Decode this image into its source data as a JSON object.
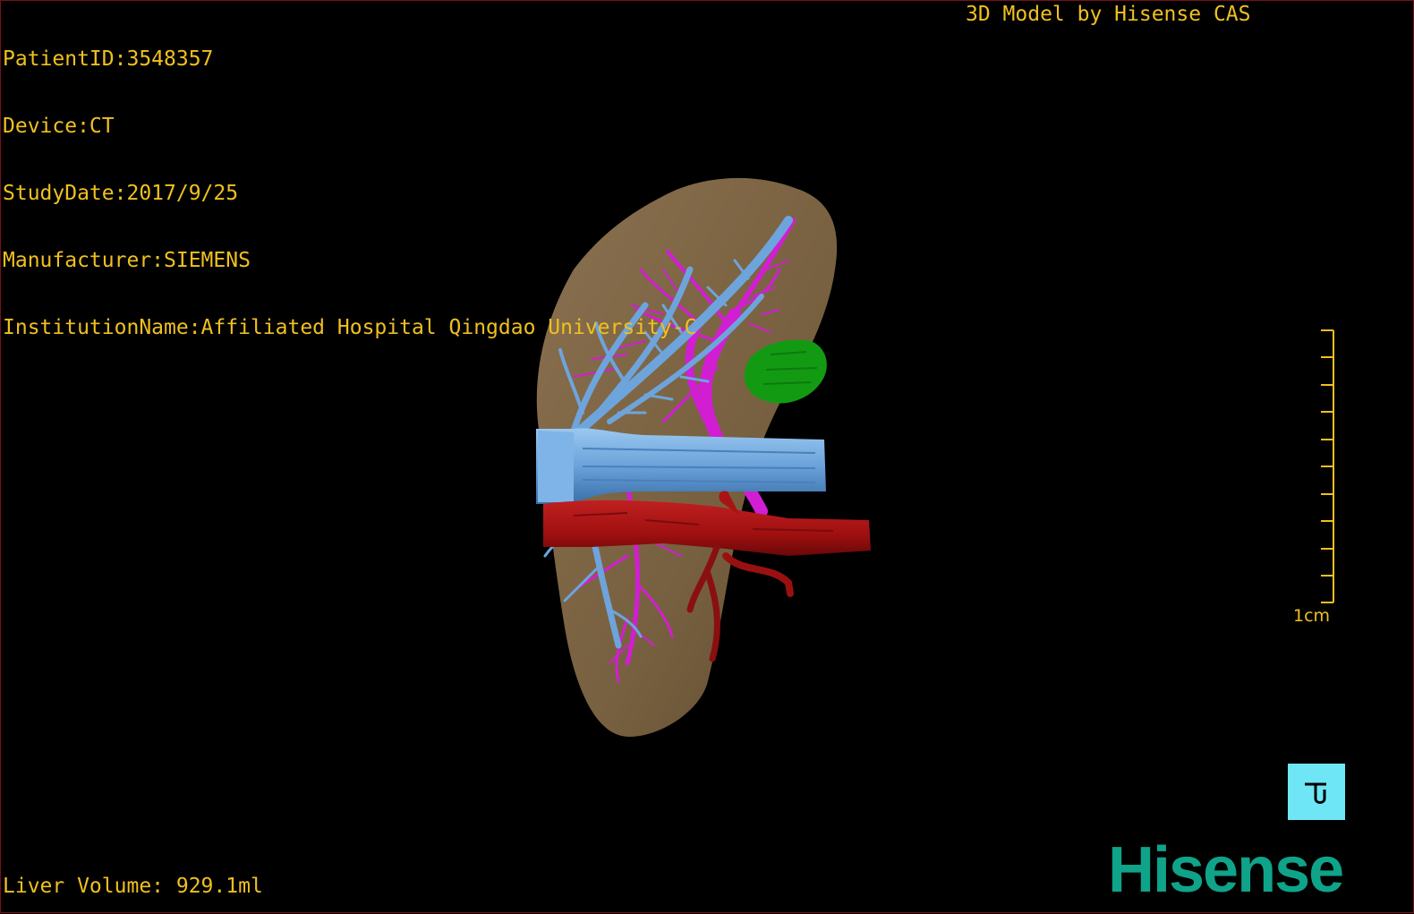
{
  "patient_info": {
    "patient_id": "PatientID:3548357",
    "device": "Device:CT",
    "study_date": "StudyDate:2017/9/25",
    "manufacturer": "Manufacturer:SIEMENS",
    "institution": "InstitutionName:Affiliated Hospital Qingdao University-C"
  },
  "header_title": "3D Model by Hisense CAS",
  "liver_volume": "Liver Volume: 929.1ml",
  "scale_label": "1cm",
  "logo_text": "Hisense",
  "colors": {
    "overlay_text": "#f0c020",
    "liver": "#7d6444",
    "portal_vein": "#6ea4dc",
    "hepatic_vein": "#d21ed2",
    "artery": "#a81414",
    "gallbladder": "#139a13",
    "logo": "#0fa38a",
    "orientation_button": "#6fe6f5"
  },
  "icons": {
    "orientation_cube": "orientation-cube-icon"
  }
}
